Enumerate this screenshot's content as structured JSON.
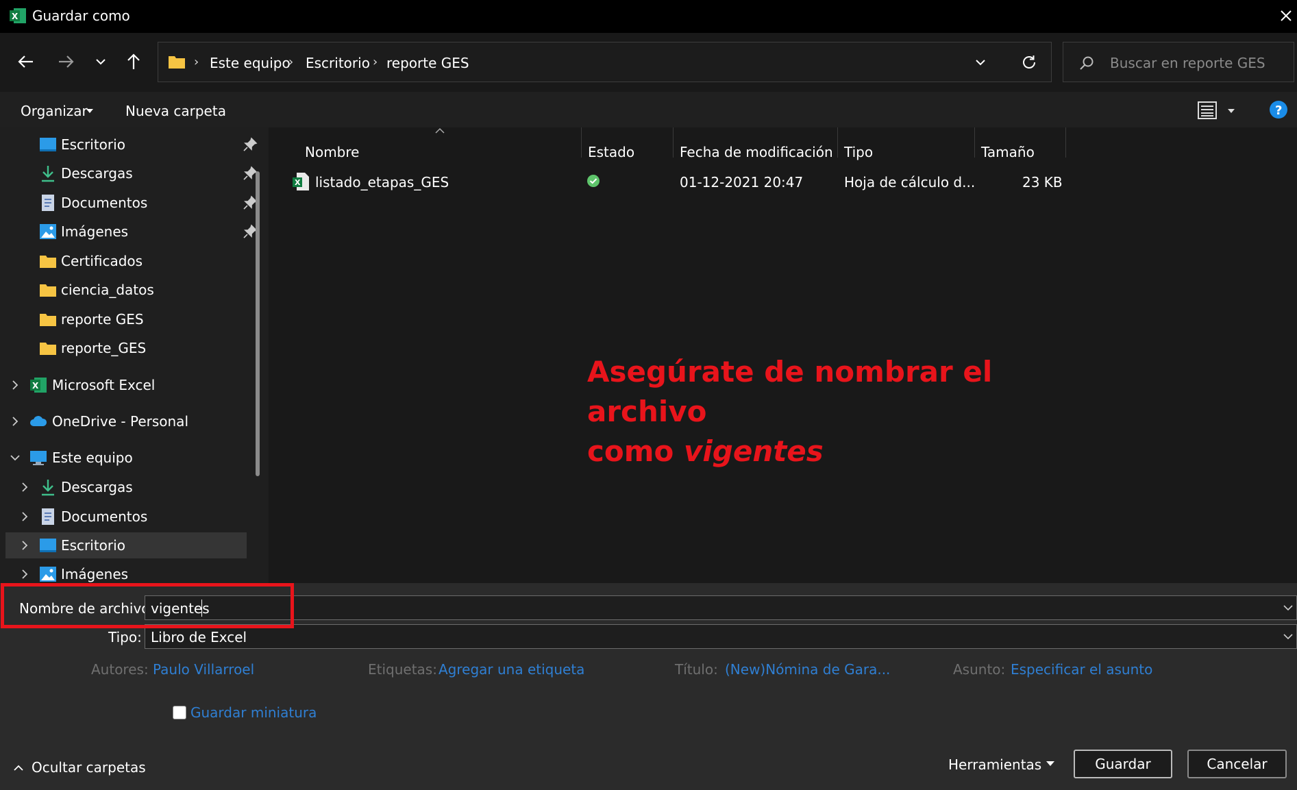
{
  "window": {
    "title": "Guardar como"
  },
  "address": {
    "crumbs": [
      "Este equipo",
      "Escritorio",
      "reporte GES"
    ]
  },
  "search": {
    "placeholder": "Buscar en reporte GES"
  },
  "toolbar": {
    "organize": "Organizar",
    "new_folder": "Nueva carpeta"
  },
  "sidebar": {
    "quick": [
      {
        "label": "Escritorio",
        "icon": "desktop-icon",
        "pinned": true
      },
      {
        "label": "Descargas",
        "icon": "download-icon",
        "pinned": true
      },
      {
        "label": "Documentos",
        "icon": "document-icon",
        "pinned": true
      },
      {
        "label": "Imágenes",
        "icon": "pictures-icon",
        "pinned": true
      },
      {
        "label": "Certificados",
        "icon": "folder-icon",
        "pinned": false
      },
      {
        "label": "ciencia_datos",
        "icon": "folder-icon",
        "pinned": false
      },
      {
        "label": "reporte GES",
        "icon": "folder-icon",
        "pinned": false
      },
      {
        "label": "reporte_GES",
        "icon": "folder-icon",
        "pinned": false
      }
    ],
    "roots": [
      {
        "label": "Microsoft Excel",
        "icon": "excel-icon"
      },
      {
        "label": "OneDrive - Personal",
        "icon": "cloud-icon"
      },
      {
        "label": "Este equipo",
        "icon": "computer-icon"
      }
    ],
    "pc": [
      {
        "label": "Descargas",
        "icon": "download-icon"
      },
      {
        "label": "Documentos",
        "icon": "document-icon"
      },
      {
        "label": "Escritorio",
        "icon": "desktop-icon"
      },
      {
        "label": "Imágenes",
        "icon": "pictures-icon"
      }
    ]
  },
  "table": {
    "headers": [
      "Nombre",
      "Estado",
      "Fecha de modificación",
      "Tipo",
      "Tamaño"
    ],
    "rows": [
      {
        "name": "listado_etapas_GES",
        "date": "01-12-2021 20:47",
        "type": "Hoja de cálculo d...",
        "size": "23 KB"
      }
    ]
  },
  "annotation": {
    "line1": "Asegúrate de nombrar el archivo",
    "line2_prefix": "como ",
    "line2_em": "vigentes"
  },
  "form": {
    "filename_label": "Nombre de archivo:",
    "filename_value": "vigentes",
    "type_label": "Tipo:",
    "type_value": "Libro de Excel",
    "authors_label": "Autores:",
    "authors_value": "Paulo Villarroel",
    "tags_label": "Etiquetas:",
    "tags_value": "Agregar una etiqueta",
    "title_label": "Título:",
    "title_value": "(New)Nómina de Gara...",
    "subject_label": "Asunto:",
    "subject_value": "Especificar el asunto",
    "thumbnail_label": "Guardar miniatura"
  },
  "footer": {
    "hide_folders": "Ocultar carpetas",
    "tools": "Herramientas",
    "save": "Guardar",
    "cancel": "Cancelar"
  },
  "colors": {
    "accent": "#2f7fd3",
    "annotation": "#e8141b",
    "folder": "#f6c443"
  }
}
